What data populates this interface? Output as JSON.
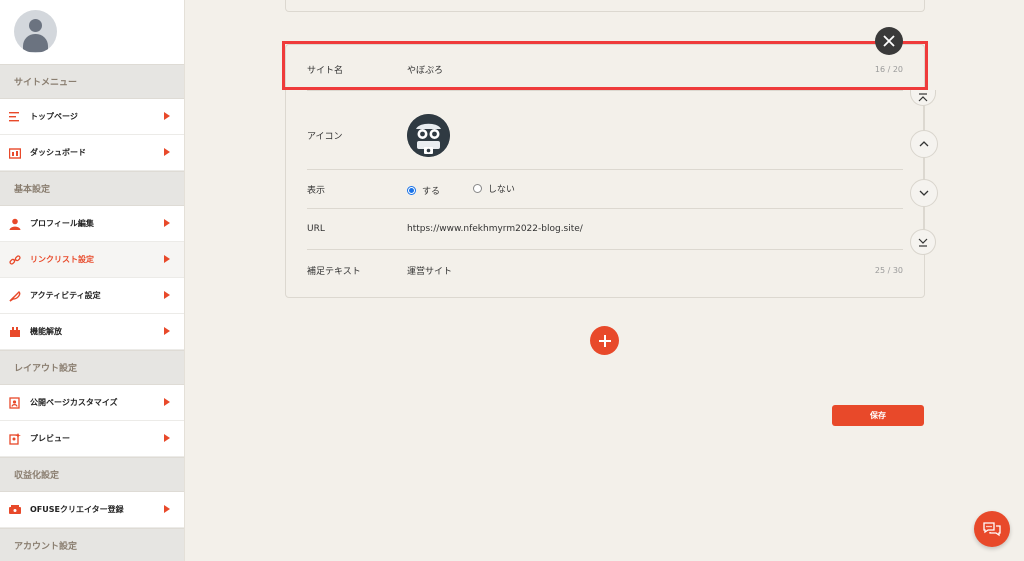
{
  "colors": {
    "accent": "#e8492a",
    "highlight": "#ef3b3b",
    "radio": "#1a73e8"
  },
  "sidebar": {
    "sections": [
      {
        "title": "サイトメニュー",
        "items": [
          {
            "label": "トップページ",
            "icon": "list-icon"
          },
          {
            "label": "ダッシュボード",
            "icon": "dashboard-icon"
          }
        ]
      },
      {
        "title": "基本設定",
        "items": [
          {
            "label": "プロフィール編集",
            "icon": "user-icon"
          },
          {
            "label": "リンクリスト設定",
            "icon": "link-icon",
            "active": true
          },
          {
            "label": "アクティビティ設定",
            "icon": "feather-icon"
          },
          {
            "label": "機能解放",
            "icon": "unlock-icon"
          }
        ]
      },
      {
        "title": "レイアウト設定",
        "items": [
          {
            "label": "公開ページカスタマイズ",
            "icon": "customize-icon"
          },
          {
            "label": "プレビュー",
            "icon": "preview-icon"
          }
        ]
      },
      {
        "title": "収益化設定",
        "items": [
          {
            "label": "OFUSEクリエイター登録",
            "icon": "ofuse-icon"
          }
        ]
      },
      {
        "title": "アカウント設定",
        "items": []
      }
    ]
  },
  "link_form": {
    "site_name": {
      "label": "サイト名",
      "value": "やぼぷろ",
      "count": "16 / 20"
    },
    "icon": {
      "label": "アイコン",
      "icon": "site-avatar-icon"
    },
    "display": {
      "label": "表示",
      "option_on": "する",
      "option_off": "しない",
      "selected": "on"
    },
    "url": {
      "label": "URL",
      "value": "https://www.nfekhmyrm2022-blog.site/"
    },
    "supplement": {
      "label": "補足テキスト",
      "value": "運営サイト",
      "count": "25 / 30"
    }
  },
  "buttons": {
    "save": "保存",
    "close_icon": "close-icon",
    "add_icon": "plus-icon",
    "chat_icon": "chat-icon"
  }
}
